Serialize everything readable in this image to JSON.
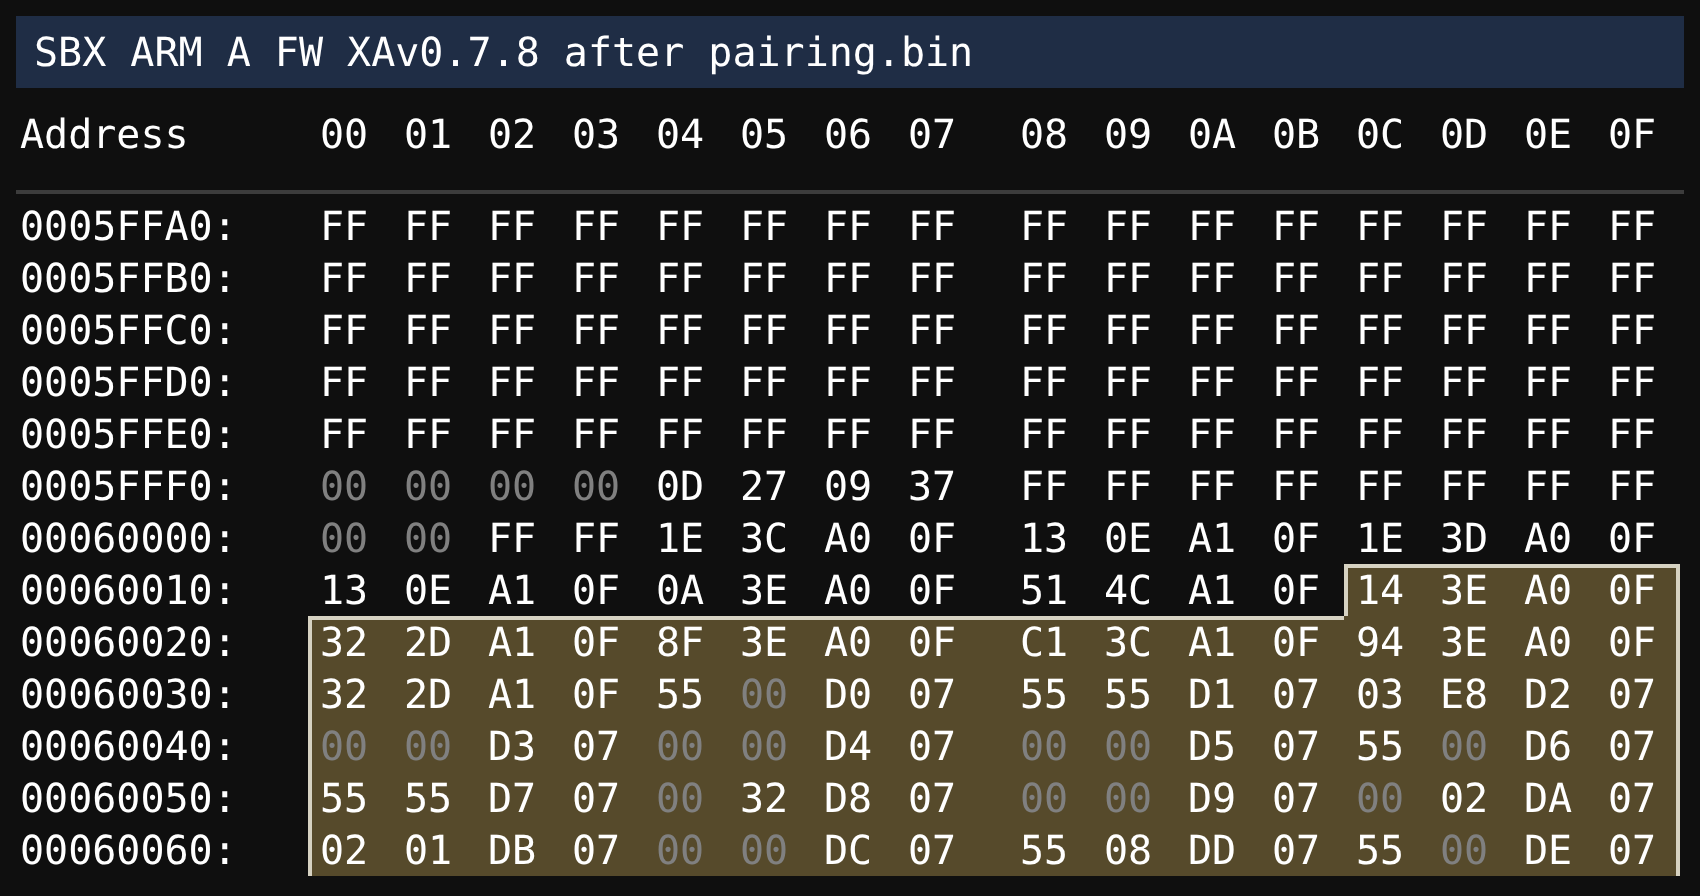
{
  "window": {
    "title": "SBX ARM A FW XAv0.7.8 after pairing.bin"
  },
  "header": {
    "address_label": "Address",
    "columns": [
      "00",
      "01",
      "02",
      "03",
      "04",
      "05",
      "06",
      "07",
      "08",
      "09",
      "0A",
      "0B",
      "0C",
      "0D",
      "0E",
      "0F"
    ]
  },
  "rows": [
    {
      "address": "0005FFA0:",
      "bytes": [
        {
          "value": "FF",
          "dimmed": false,
          "selected": false
        },
        {
          "value": "FF",
          "dimmed": false,
          "selected": false
        },
        {
          "value": "FF",
          "dimmed": false,
          "selected": false
        },
        {
          "value": "FF",
          "dimmed": false,
          "selected": false
        },
        {
          "value": "FF",
          "dimmed": false,
          "selected": false
        },
        {
          "value": "FF",
          "dimmed": false,
          "selected": false
        },
        {
          "value": "FF",
          "dimmed": false,
          "selected": false
        },
        {
          "value": "FF",
          "dimmed": false,
          "selected": false
        },
        {
          "value": "FF",
          "dimmed": false,
          "selected": false
        },
        {
          "value": "FF",
          "dimmed": false,
          "selected": false
        },
        {
          "value": "FF",
          "dimmed": false,
          "selected": false
        },
        {
          "value": "FF",
          "dimmed": false,
          "selected": false
        },
        {
          "value": "FF",
          "dimmed": false,
          "selected": false
        },
        {
          "value": "FF",
          "dimmed": false,
          "selected": false
        },
        {
          "value": "FF",
          "dimmed": false,
          "selected": false
        },
        {
          "value": "FF",
          "dimmed": false,
          "selected": false
        }
      ]
    },
    {
      "address": "0005FFB0:",
      "bytes": [
        {
          "value": "FF",
          "dimmed": false,
          "selected": false
        },
        {
          "value": "FF",
          "dimmed": false,
          "selected": false
        },
        {
          "value": "FF",
          "dimmed": false,
          "selected": false
        },
        {
          "value": "FF",
          "dimmed": false,
          "selected": false
        },
        {
          "value": "FF",
          "dimmed": false,
          "selected": false
        },
        {
          "value": "FF",
          "dimmed": false,
          "selected": false
        },
        {
          "value": "FF",
          "dimmed": false,
          "selected": false
        },
        {
          "value": "FF",
          "dimmed": false,
          "selected": false
        },
        {
          "value": "FF",
          "dimmed": false,
          "selected": false
        },
        {
          "value": "FF",
          "dimmed": false,
          "selected": false
        },
        {
          "value": "FF",
          "dimmed": false,
          "selected": false
        },
        {
          "value": "FF",
          "dimmed": false,
          "selected": false
        },
        {
          "value": "FF",
          "dimmed": false,
          "selected": false
        },
        {
          "value": "FF",
          "dimmed": false,
          "selected": false
        },
        {
          "value": "FF",
          "dimmed": false,
          "selected": false
        },
        {
          "value": "FF",
          "dimmed": false,
          "selected": false
        }
      ]
    },
    {
      "address": "0005FFC0:",
      "bytes": [
        {
          "value": "FF",
          "dimmed": false,
          "selected": false
        },
        {
          "value": "FF",
          "dimmed": false,
          "selected": false
        },
        {
          "value": "FF",
          "dimmed": false,
          "selected": false
        },
        {
          "value": "FF",
          "dimmed": false,
          "selected": false
        },
        {
          "value": "FF",
          "dimmed": false,
          "selected": false
        },
        {
          "value": "FF",
          "dimmed": false,
          "selected": false
        },
        {
          "value": "FF",
          "dimmed": false,
          "selected": false
        },
        {
          "value": "FF",
          "dimmed": false,
          "selected": false
        },
        {
          "value": "FF",
          "dimmed": false,
          "selected": false
        },
        {
          "value": "FF",
          "dimmed": false,
          "selected": false
        },
        {
          "value": "FF",
          "dimmed": false,
          "selected": false
        },
        {
          "value": "FF",
          "dimmed": false,
          "selected": false
        },
        {
          "value": "FF",
          "dimmed": false,
          "selected": false
        },
        {
          "value": "FF",
          "dimmed": false,
          "selected": false
        },
        {
          "value": "FF",
          "dimmed": false,
          "selected": false
        },
        {
          "value": "FF",
          "dimmed": false,
          "selected": false
        }
      ]
    },
    {
      "address": "0005FFD0:",
      "bytes": [
        {
          "value": "FF",
          "dimmed": false,
          "selected": false
        },
        {
          "value": "FF",
          "dimmed": false,
          "selected": false
        },
        {
          "value": "FF",
          "dimmed": false,
          "selected": false
        },
        {
          "value": "FF",
          "dimmed": false,
          "selected": false
        },
        {
          "value": "FF",
          "dimmed": false,
          "selected": false
        },
        {
          "value": "FF",
          "dimmed": false,
          "selected": false
        },
        {
          "value": "FF",
          "dimmed": false,
          "selected": false
        },
        {
          "value": "FF",
          "dimmed": false,
          "selected": false
        },
        {
          "value": "FF",
          "dimmed": false,
          "selected": false
        },
        {
          "value": "FF",
          "dimmed": false,
          "selected": false
        },
        {
          "value": "FF",
          "dimmed": false,
          "selected": false
        },
        {
          "value": "FF",
          "dimmed": false,
          "selected": false
        },
        {
          "value": "FF",
          "dimmed": false,
          "selected": false
        },
        {
          "value": "FF",
          "dimmed": false,
          "selected": false
        },
        {
          "value": "FF",
          "dimmed": false,
          "selected": false
        },
        {
          "value": "FF",
          "dimmed": false,
          "selected": false
        }
      ]
    },
    {
      "address": "0005FFE0:",
      "bytes": [
        {
          "value": "FF",
          "dimmed": false,
          "selected": false
        },
        {
          "value": "FF",
          "dimmed": false,
          "selected": false
        },
        {
          "value": "FF",
          "dimmed": false,
          "selected": false
        },
        {
          "value": "FF",
          "dimmed": false,
          "selected": false
        },
        {
          "value": "FF",
          "dimmed": false,
          "selected": false
        },
        {
          "value": "FF",
          "dimmed": false,
          "selected": false
        },
        {
          "value": "FF",
          "dimmed": false,
          "selected": false
        },
        {
          "value": "FF",
          "dimmed": false,
          "selected": false
        },
        {
          "value": "FF",
          "dimmed": false,
          "selected": false
        },
        {
          "value": "FF",
          "dimmed": false,
          "selected": false
        },
        {
          "value": "FF",
          "dimmed": false,
          "selected": false
        },
        {
          "value": "FF",
          "dimmed": false,
          "selected": false
        },
        {
          "value": "FF",
          "dimmed": false,
          "selected": false
        },
        {
          "value": "FF",
          "dimmed": false,
          "selected": false
        },
        {
          "value": "FF",
          "dimmed": false,
          "selected": false
        },
        {
          "value": "FF",
          "dimmed": false,
          "selected": false
        }
      ]
    },
    {
      "address": "0005FFF0:",
      "bytes": [
        {
          "value": "00",
          "dimmed": true,
          "selected": false
        },
        {
          "value": "00",
          "dimmed": true,
          "selected": false
        },
        {
          "value": "00",
          "dimmed": true,
          "selected": false
        },
        {
          "value": "00",
          "dimmed": true,
          "selected": false
        },
        {
          "value": "0D",
          "dimmed": false,
          "selected": false
        },
        {
          "value": "27",
          "dimmed": false,
          "selected": false
        },
        {
          "value": "09",
          "dimmed": false,
          "selected": false
        },
        {
          "value": "37",
          "dimmed": false,
          "selected": false
        },
        {
          "value": "FF",
          "dimmed": false,
          "selected": false
        },
        {
          "value": "FF",
          "dimmed": false,
          "selected": false
        },
        {
          "value": "FF",
          "dimmed": false,
          "selected": false
        },
        {
          "value": "FF",
          "dimmed": false,
          "selected": false
        },
        {
          "value": "FF",
          "dimmed": false,
          "selected": false
        },
        {
          "value": "FF",
          "dimmed": false,
          "selected": false
        },
        {
          "value": "FF",
          "dimmed": false,
          "selected": false
        },
        {
          "value": "FF",
          "dimmed": false,
          "selected": false
        }
      ]
    },
    {
      "address": "00060000:",
      "bytes": [
        {
          "value": "00",
          "dimmed": true,
          "selected": false
        },
        {
          "value": "00",
          "dimmed": true,
          "selected": false
        },
        {
          "value": "FF",
          "dimmed": false,
          "selected": false
        },
        {
          "value": "FF",
          "dimmed": false,
          "selected": false
        },
        {
          "value": "1E",
          "dimmed": false,
          "selected": false
        },
        {
          "value": "3C",
          "dimmed": false,
          "selected": false
        },
        {
          "value": "A0",
          "dimmed": false,
          "selected": false
        },
        {
          "value": "0F",
          "dimmed": false,
          "selected": false
        },
        {
          "value": "13",
          "dimmed": false,
          "selected": false
        },
        {
          "value": "0E",
          "dimmed": false,
          "selected": false
        },
        {
          "value": "A1",
          "dimmed": false,
          "selected": false
        },
        {
          "value": "0F",
          "dimmed": false,
          "selected": false
        },
        {
          "value": "1E",
          "dimmed": false,
          "selected": false
        },
        {
          "value": "3D",
          "dimmed": false,
          "selected": false
        },
        {
          "value": "A0",
          "dimmed": false,
          "selected": false
        },
        {
          "value": "0F",
          "dimmed": false,
          "selected": false
        }
      ]
    },
    {
      "address": "00060010:",
      "bytes": [
        {
          "value": "13",
          "dimmed": false,
          "selected": false
        },
        {
          "value": "0E",
          "dimmed": false,
          "selected": false
        },
        {
          "value": "A1",
          "dimmed": false,
          "selected": false
        },
        {
          "value": "0F",
          "dimmed": false,
          "selected": false
        },
        {
          "value": "0A",
          "dimmed": false,
          "selected": false
        },
        {
          "value": "3E",
          "dimmed": false,
          "selected": false
        },
        {
          "value": "A0",
          "dimmed": false,
          "selected": false
        },
        {
          "value": "0F",
          "dimmed": false,
          "selected": false
        },
        {
          "value": "51",
          "dimmed": false,
          "selected": false
        },
        {
          "value": "4C",
          "dimmed": false,
          "selected": false
        },
        {
          "value": "A1",
          "dimmed": false,
          "selected": false
        },
        {
          "value": "0F",
          "dimmed": false,
          "selected": false
        },
        {
          "value": "14",
          "dimmed": false,
          "selected": true
        },
        {
          "value": "3E",
          "dimmed": false,
          "selected": true
        },
        {
          "value": "A0",
          "dimmed": false,
          "selected": true
        },
        {
          "value": "0F",
          "dimmed": false,
          "selected": true
        }
      ]
    },
    {
      "address": "00060020:",
      "bytes": [
        {
          "value": "32",
          "dimmed": false,
          "selected": true
        },
        {
          "value": "2D",
          "dimmed": false,
          "selected": true
        },
        {
          "value": "A1",
          "dimmed": false,
          "selected": true
        },
        {
          "value": "0F",
          "dimmed": false,
          "selected": true
        },
        {
          "value": "8F",
          "dimmed": false,
          "selected": true
        },
        {
          "value": "3E",
          "dimmed": false,
          "selected": true
        },
        {
          "value": "A0",
          "dimmed": false,
          "selected": true
        },
        {
          "value": "0F",
          "dimmed": false,
          "selected": true
        },
        {
          "value": "C1",
          "dimmed": false,
          "selected": true
        },
        {
          "value": "3C",
          "dimmed": false,
          "selected": true
        },
        {
          "value": "A1",
          "dimmed": false,
          "selected": true
        },
        {
          "value": "0F",
          "dimmed": false,
          "selected": true
        },
        {
          "value": "94",
          "dimmed": false,
          "selected": true
        },
        {
          "value": "3E",
          "dimmed": false,
          "selected": true
        },
        {
          "value": "A0",
          "dimmed": false,
          "selected": true
        },
        {
          "value": "0F",
          "dimmed": false,
          "selected": true
        }
      ]
    },
    {
      "address": "00060030:",
      "bytes": [
        {
          "value": "32",
          "dimmed": false,
          "selected": true
        },
        {
          "value": "2D",
          "dimmed": false,
          "selected": true
        },
        {
          "value": "A1",
          "dimmed": false,
          "selected": true
        },
        {
          "value": "0F",
          "dimmed": false,
          "selected": true
        },
        {
          "value": "55",
          "dimmed": false,
          "selected": true
        },
        {
          "value": "00",
          "dimmed": true,
          "selected": true
        },
        {
          "value": "D0",
          "dimmed": false,
          "selected": true
        },
        {
          "value": "07",
          "dimmed": false,
          "selected": true
        },
        {
          "value": "55",
          "dimmed": false,
          "selected": true
        },
        {
          "value": "55",
          "dimmed": false,
          "selected": true
        },
        {
          "value": "D1",
          "dimmed": false,
          "selected": true
        },
        {
          "value": "07",
          "dimmed": false,
          "selected": true
        },
        {
          "value": "03",
          "dimmed": false,
          "selected": true
        },
        {
          "value": "E8",
          "dimmed": false,
          "selected": true
        },
        {
          "value": "D2",
          "dimmed": false,
          "selected": true
        },
        {
          "value": "07",
          "dimmed": false,
          "selected": true
        }
      ]
    },
    {
      "address": "00060040:",
      "bytes": [
        {
          "value": "00",
          "dimmed": true,
          "selected": true
        },
        {
          "value": "00",
          "dimmed": true,
          "selected": true
        },
        {
          "value": "D3",
          "dimmed": false,
          "selected": true
        },
        {
          "value": "07",
          "dimmed": false,
          "selected": true
        },
        {
          "value": "00",
          "dimmed": true,
          "selected": true
        },
        {
          "value": "00",
          "dimmed": true,
          "selected": true
        },
        {
          "value": "D4",
          "dimmed": false,
          "selected": true
        },
        {
          "value": "07",
          "dimmed": false,
          "selected": true
        },
        {
          "value": "00",
          "dimmed": true,
          "selected": true
        },
        {
          "value": "00",
          "dimmed": true,
          "selected": true
        },
        {
          "value": "D5",
          "dimmed": false,
          "selected": true
        },
        {
          "value": "07",
          "dimmed": false,
          "selected": true
        },
        {
          "value": "55",
          "dimmed": false,
          "selected": true
        },
        {
          "value": "00",
          "dimmed": true,
          "selected": true
        },
        {
          "value": "D6",
          "dimmed": false,
          "selected": true
        },
        {
          "value": "07",
          "dimmed": false,
          "selected": true
        }
      ]
    },
    {
      "address": "00060050:",
      "bytes": [
        {
          "value": "55",
          "dimmed": false,
          "selected": true
        },
        {
          "value": "55",
          "dimmed": false,
          "selected": true
        },
        {
          "value": "D7",
          "dimmed": false,
          "selected": true
        },
        {
          "value": "07",
          "dimmed": false,
          "selected": true
        },
        {
          "value": "00",
          "dimmed": true,
          "selected": true
        },
        {
          "value": "32",
          "dimmed": false,
          "selected": true
        },
        {
          "value": "D8",
          "dimmed": false,
          "selected": true
        },
        {
          "value": "07",
          "dimmed": false,
          "selected": true
        },
        {
          "value": "00",
          "dimmed": true,
          "selected": true
        },
        {
          "value": "00",
          "dimmed": true,
          "selected": true
        },
        {
          "value": "D9",
          "dimmed": false,
          "selected": true
        },
        {
          "value": "07",
          "dimmed": false,
          "selected": true
        },
        {
          "value": "00",
          "dimmed": true,
          "selected": true
        },
        {
          "value": "02",
          "dimmed": false,
          "selected": true
        },
        {
          "value": "DA",
          "dimmed": false,
          "selected": true
        },
        {
          "value": "07",
          "dimmed": false,
          "selected": true
        }
      ]
    },
    {
      "address": "00060060:",
      "bytes": [
        {
          "value": "02",
          "dimmed": false,
          "selected": true
        },
        {
          "value": "01",
          "dimmed": false,
          "selected": true
        },
        {
          "value": "DB",
          "dimmed": false,
          "selected": true
        },
        {
          "value": "07",
          "dimmed": false,
          "selected": true
        },
        {
          "value": "00",
          "dimmed": true,
          "selected": true
        },
        {
          "value": "00",
          "dimmed": true,
          "selected": true
        },
        {
          "value": "DC",
          "dimmed": false,
          "selected": true
        },
        {
          "value": "07",
          "dimmed": false,
          "selected": true
        },
        {
          "value": "55",
          "dimmed": false,
          "selected": true
        },
        {
          "value": "08",
          "dimmed": false,
          "selected": true
        },
        {
          "value": "DD",
          "dimmed": false,
          "selected": true
        },
        {
          "value": "07",
          "dimmed": false,
          "selected": true
        },
        {
          "value": "55",
          "dimmed": false,
          "selected": true
        },
        {
          "value": "00",
          "dimmed": true,
          "selected": true
        },
        {
          "value": "DE",
          "dimmed": false,
          "selected": true
        },
        {
          "value": "07",
          "dimmed": false,
          "selected": true
        }
      ]
    }
  ]
}
